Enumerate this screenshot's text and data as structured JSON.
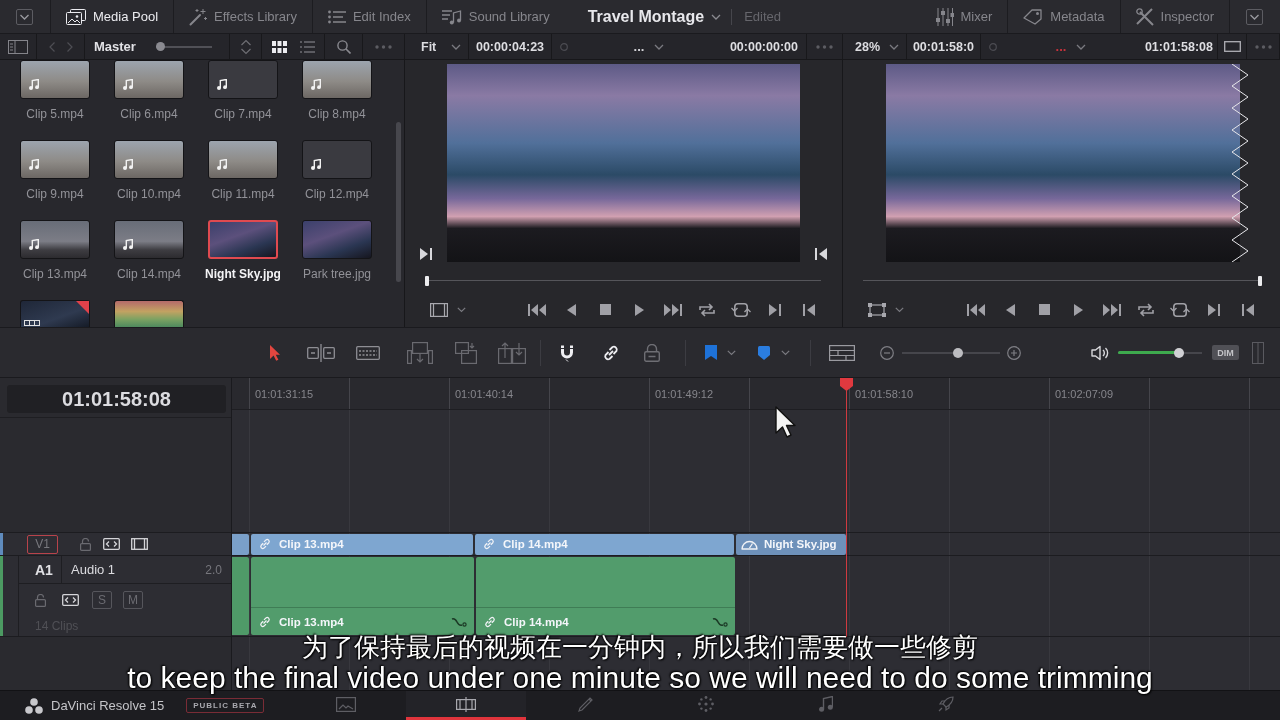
{
  "top_bar": {
    "left_panels": [
      {
        "kind": "media_pool",
        "label": "Media Pool",
        "selected": true
      },
      {
        "kind": "effects",
        "label": "Effects Library",
        "selected": false
      },
      {
        "kind": "edit_index",
        "label": "Edit Index",
        "selected": false
      },
      {
        "kind": "sound",
        "label": "Sound Library",
        "selected": false
      }
    ],
    "project": {
      "title": "Travel Montage",
      "status": "Edited"
    },
    "right_panels": [
      {
        "kind": "mixer",
        "label": "Mixer",
        "selected": false
      },
      {
        "kind": "metadata",
        "label": "Metadata",
        "selected": false
      },
      {
        "kind": "inspector",
        "label": "Inspector",
        "selected": false
      }
    ]
  },
  "media_pool": {
    "bin": "Master",
    "thumb_size": {
      "level": 0
    },
    "view_modes": [
      {
        "kind": "grid",
        "selected": true
      },
      {
        "kind": "list",
        "selected": false
      }
    ],
    "clips": [
      {
        "name": "Clip 5.mp4",
        "kind": "day",
        "audio": true,
        "flagged": false,
        "selected": false
      },
      {
        "name": "Clip 6.mp4",
        "kind": "day",
        "audio": true,
        "flagged": false,
        "selected": false
      },
      {
        "name": "Clip 7.mp4",
        "kind": "blank",
        "audio": true,
        "flagged": false,
        "selected": false
      },
      {
        "name": "Clip 8.mp4",
        "kind": "day",
        "audio": true,
        "flagged": false,
        "selected": false
      },
      {
        "name": "Clip 9.mp4",
        "kind": "day",
        "audio": true,
        "flagged": false,
        "selected": false
      },
      {
        "name": "Clip 10.mp4",
        "kind": "day",
        "audio": true,
        "flagged": false,
        "selected": false
      },
      {
        "name": "Clip 11.mp4",
        "kind": "day",
        "audio": true,
        "flagged": false,
        "selected": false
      },
      {
        "name": "Clip 12.mp4",
        "kind": "blank",
        "audio": true,
        "flagged": false,
        "selected": false
      },
      {
        "name": "Clip 13.mp4",
        "kind": "dusk",
        "audio": true,
        "flagged": false,
        "selected": false
      },
      {
        "name": "Clip 14.mp4",
        "kind": "dusk",
        "audio": true,
        "flagged": false,
        "selected": false
      },
      {
        "name": "Night Sky.jpg",
        "kind": "night",
        "audio": false,
        "flagged": false,
        "selected": true
      },
      {
        "name": "Park tree.jpg",
        "kind": "night",
        "audio": false,
        "flagged": false,
        "selected": false
      },
      {
        "kind": "timeline",
        "audio": false,
        "flagged": true,
        "selected": false
      },
      {
        "kind": "bars",
        "audio": false,
        "flagged": false,
        "selected": false
      }
    ]
  },
  "viewers": [
    {
      "zoom": "Fit",
      "duration": "00:00:04:23",
      "clip": "...",
      "color": "#d4d4d8",
      "timecode": "00:00:00:00",
      "level": 0
    },
    {
      "zoom": "28%",
      "duration": "00:01:58:0",
      "clip": "...",
      "color": "#c8323c",
      "timecode": "01:01:58:08",
      "level": 1
    }
  ],
  "toolbar": {
    "tools": [
      {
        "kind": "select",
        "selected": true
      },
      {
        "kind": "trim",
        "selected": false
      },
      {
        "kind": "dynamic_trim",
        "selected": false
      }
    ],
    "toggles": [
      {
        "kind": "snap",
        "on": true
      },
      {
        "kind": "link",
        "on": true
      },
      {
        "kind": "lock",
        "on": false
      }
    ],
    "zoom": {
      "level": 0.58
    },
    "volume": {
      "level": 0.76
    },
    "dim": "DIM"
  },
  "timeline": {
    "timecode": "01:01:58:08",
    "ruler": [
      "01:01:31:15",
      "01:01:40:14",
      "01:01:49:12",
      "01:01:58:10",
      "01:02:07:09"
    ],
    "tracks": [
      {
        "kind": "video",
        "id": "V1",
        "clips": [
          {
            "name": "Clip 13.mp4",
            "kind": "linked"
          },
          {
            "name": "Clip 14.mp4",
            "kind": "linked"
          },
          {
            "name": "Night Sky.jpg",
            "kind": "retimed"
          }
        ]
      },
      {
        "kind": "audio",
        "id": "A1",
        "name": "Audio 1",
        "channels": "2.0",
        "buttons": [
          {
            "label": "S",
            "on": false
          },
          {
            "label": "M",
            "on": false
          }
        ],
        "count": "14 Clips",
        "clips": [
          {
            "name": "Clip 13.mp4",
            "kind": "linked"
          },
          {
            "name": "Clip 14.mp4",
            "kind": "linked"
          }
        ]
      }
    ]
  },
  "subtitles": [
    "为了保持最后的视频在一分钟内，所以我们需要做一些修剪",
    "to keep the final video under one minute so we will need to do some trimming"
  ],
  "footer": {
    "app": "DaVinci Resolve 15",
    "badge": "PUBLIC BETA",
    "pages": [
      {
        "kind": "media",
        "selected": false
      },
      {
        "kind": "edit",
        "selected": true
      },
      {
        "kind": "fusion",
        "selected": false
      },
      {
        "kind": "color",
        "selected": false
      },
      {
        "kind": "fairlight",
        "selected": false
      },
      {
        "kind": "deliver",
        "selected": false
      }
    ]
  }
}
